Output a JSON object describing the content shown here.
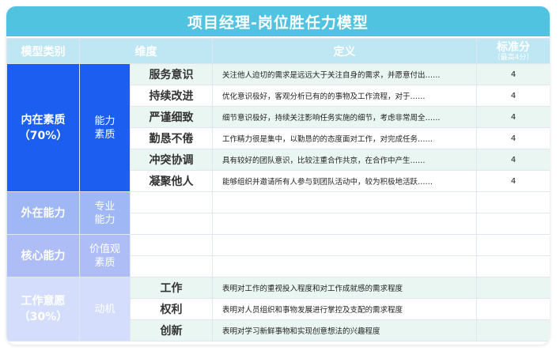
{
  "title": "项目经理-岗位胜任力模型",
  "headers": {
    "category": "模型类别",
    "dimension": "维度",
    "definition": "定义",
    "score": "标准分",
    "score_note": "（最高4分）"
  },
  "groups": [
    {
      "category": "内在素质",
      "category_note": "（70%）",
      "sub": "能力\n素质",
      "rows": [
        {
          "dim": "服务意识",
          "def": "关注他人迫切的需求是远远大于关注自身的需求，并愿意付出……",
          "score": "4"
        },
        {
          "dim": "持续改进",
          "def": "优化意识极好，客观分析已有的的事物及工作流程，对于……",
          "score": "4"
        },
        {
          "dim": "严谨细致",
          "def": "细节意识极好，持续关注影响任务实施的细节，考虑非常周全……",
          "score": "4"
        },
        {
          "dim": "勤恳不倦",
          "def": "工作精力很是集中，以勤恳的的态度面对工作，对完成任务……",
          "score": "4"
        },
        {
          "dim": "冲突协调",
          "def": "具有较好的团队意识，比较注重合作共京，在合作中产生……",
          "score": "4"
        },
        {
          "dim": "凝聚他人",
          "def": "能够组织并邀请所有人参与到团队活动中，较为积极地活跃……",
          "score": "4"
        }
      ]
    },
    {
      "category": "外在能力",
      "sub": "专业\n能力"
    },
    {
      "category": "核心能力",
      "sub": "价值观\n素质"
    },
    {
      "category": "工作意愿",
      "category_note": "（30%）",
      "sub": "动机",
      "rows": [
        {
          "dim": "工作",
          "def": "表明对工作的重视投入程度和对工作成就感的需求程度",
          "score": ""
        },
        {
          "dim": "权利",
          "def": "表明对人员组织和事物发展进行掌控及支配的需求程度",
          "score": ""
        },
        {
          "dim": "创新",
          "def": "表明对学习新鲜事物和实现创意想法的兴趣程度",
          "score": ""
        }
      ]
    }
  ],
  "colors": {
    "title_bg": "#4fc3e0",
    "header_bg": "#bfe7f3",
    "inner": "#1b5ef0",
    "outer": "#9fb7f5",
    "core": "#aebdf6",
    "will": "#d4ddfb",
    "row_alt": "#eaf6f1"
  }
}
